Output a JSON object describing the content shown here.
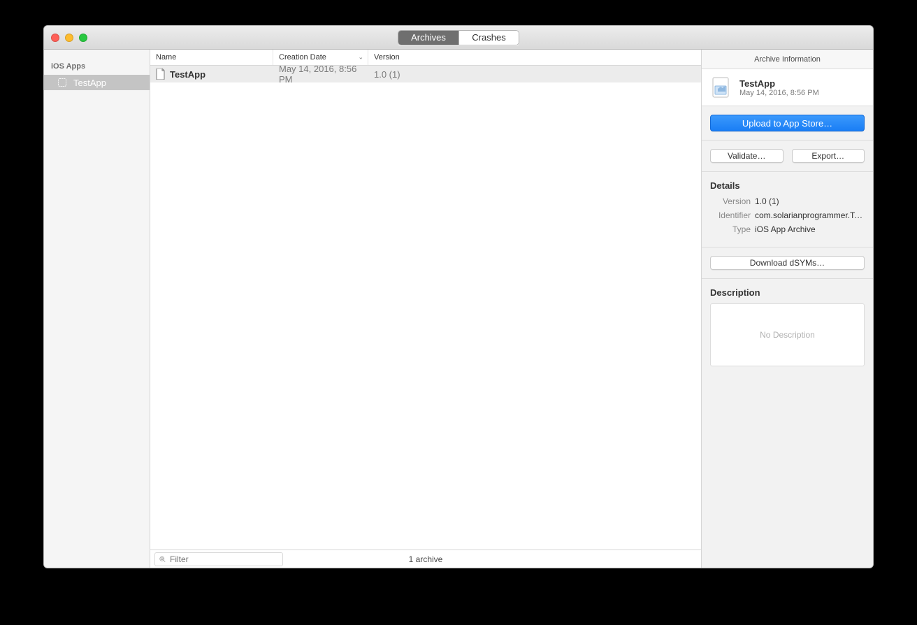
{
  "titlebar": {
    "tabs": [
      "Archives",
      "Crashes"
    ],
    "active_tab": 0
  },
  "sidebar": {
    "header": "iOS Apps",
    "items": [
      {
        "label": "TestApp"
      }
    ]
  },
  "columns": {
    "name": "Name",
    "date": "Creation Date",
    "version": "Version"
  },
  "rows": [
    {
      "name": "TestApp",
      "date": "May 14, 2016, 8:56 PM",
      "version": "1.0 (1)"
    }
  ],
  "status": {
    "filter_placeholder": "Filter",
    "count_text": "1 archive"
  },
  "inspector": {
    "title": "Archive Information",
    "app_name": "TestApp",
    "app_date": "May 14, 2016, 8:56 PM",
    "upload_label": "Upload to App Store…",
    "validate_label": "Validate…",
    "export_label": "Export…",
    "details_label": "Details",
    "version_label": "Version",
    "version_value": "1.0 (1)",
    "identifier_label": "Identifier",
    "identifier_value": "com.solarianprogrammer.Te…",
    "type_label": "Type",
    "type_value": "iOS App Archive",
    "download_dsyms_label": "Download dSYMs…",
    "description_label": "Description",
    "no_description": "No Description"
  }
}
